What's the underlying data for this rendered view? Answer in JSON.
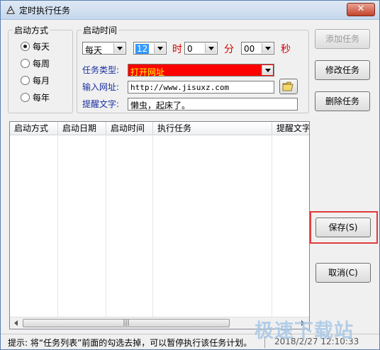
{
  "window": {
    "title": "定时执行任务",
    "close_glyph": "✕"
  },
  "startup_mode": {
    "legend": "启动方式",
    "options": [
      "每天",
      "每周",
      "每月",
      "每年"
    ],
    "selected": "每天"
  },
  "startup_time": {
    "legend": "启动时间",
    "frequency": "每天",
    "hour": "12",
    "hour_unit": "时",
    "minute": "0",
    "minute_unit": "分",
    "second": "00",
    "second_unit": "秒",
    "task_type_label": "任务类型:",
    "task_type_value": "打开网址",
    "url_label": "输入网址:",
    "url_value": "http://www.jisuxz.com",
    "reminder_label": "提醒文字:",
    "reminder_value": "懒虫，起床了。"
  },
  "buttons": {
    "add": "添加任务",
    "modify": "修改任务",
    "delete": "删除任务",
    "save": "保存(S)",
    "cancel": "取消(C)"
  },
  "task_list": {
    "columns": [
      "启动方式",
      "启动日期",
      "启动时间",
      "执行任务",
      "提醒文字"
    ],
    "rows": [],
    "scroll_thumb_glyph": "|||"
  },
  "status": {
    "hint": "提示: 将“任务列表”前面的勾选去掉，可以暂停执行该任务计划。",
    "datetime": "2018/2/27  12:10:33"
  },
  "watermark": "极速下载站",
  "colors": {
    "accent_red": "#e03c3c",
    "task_type_bg": "#ff0000",
    "label_blue": "#1a2fa0"
  }
}
